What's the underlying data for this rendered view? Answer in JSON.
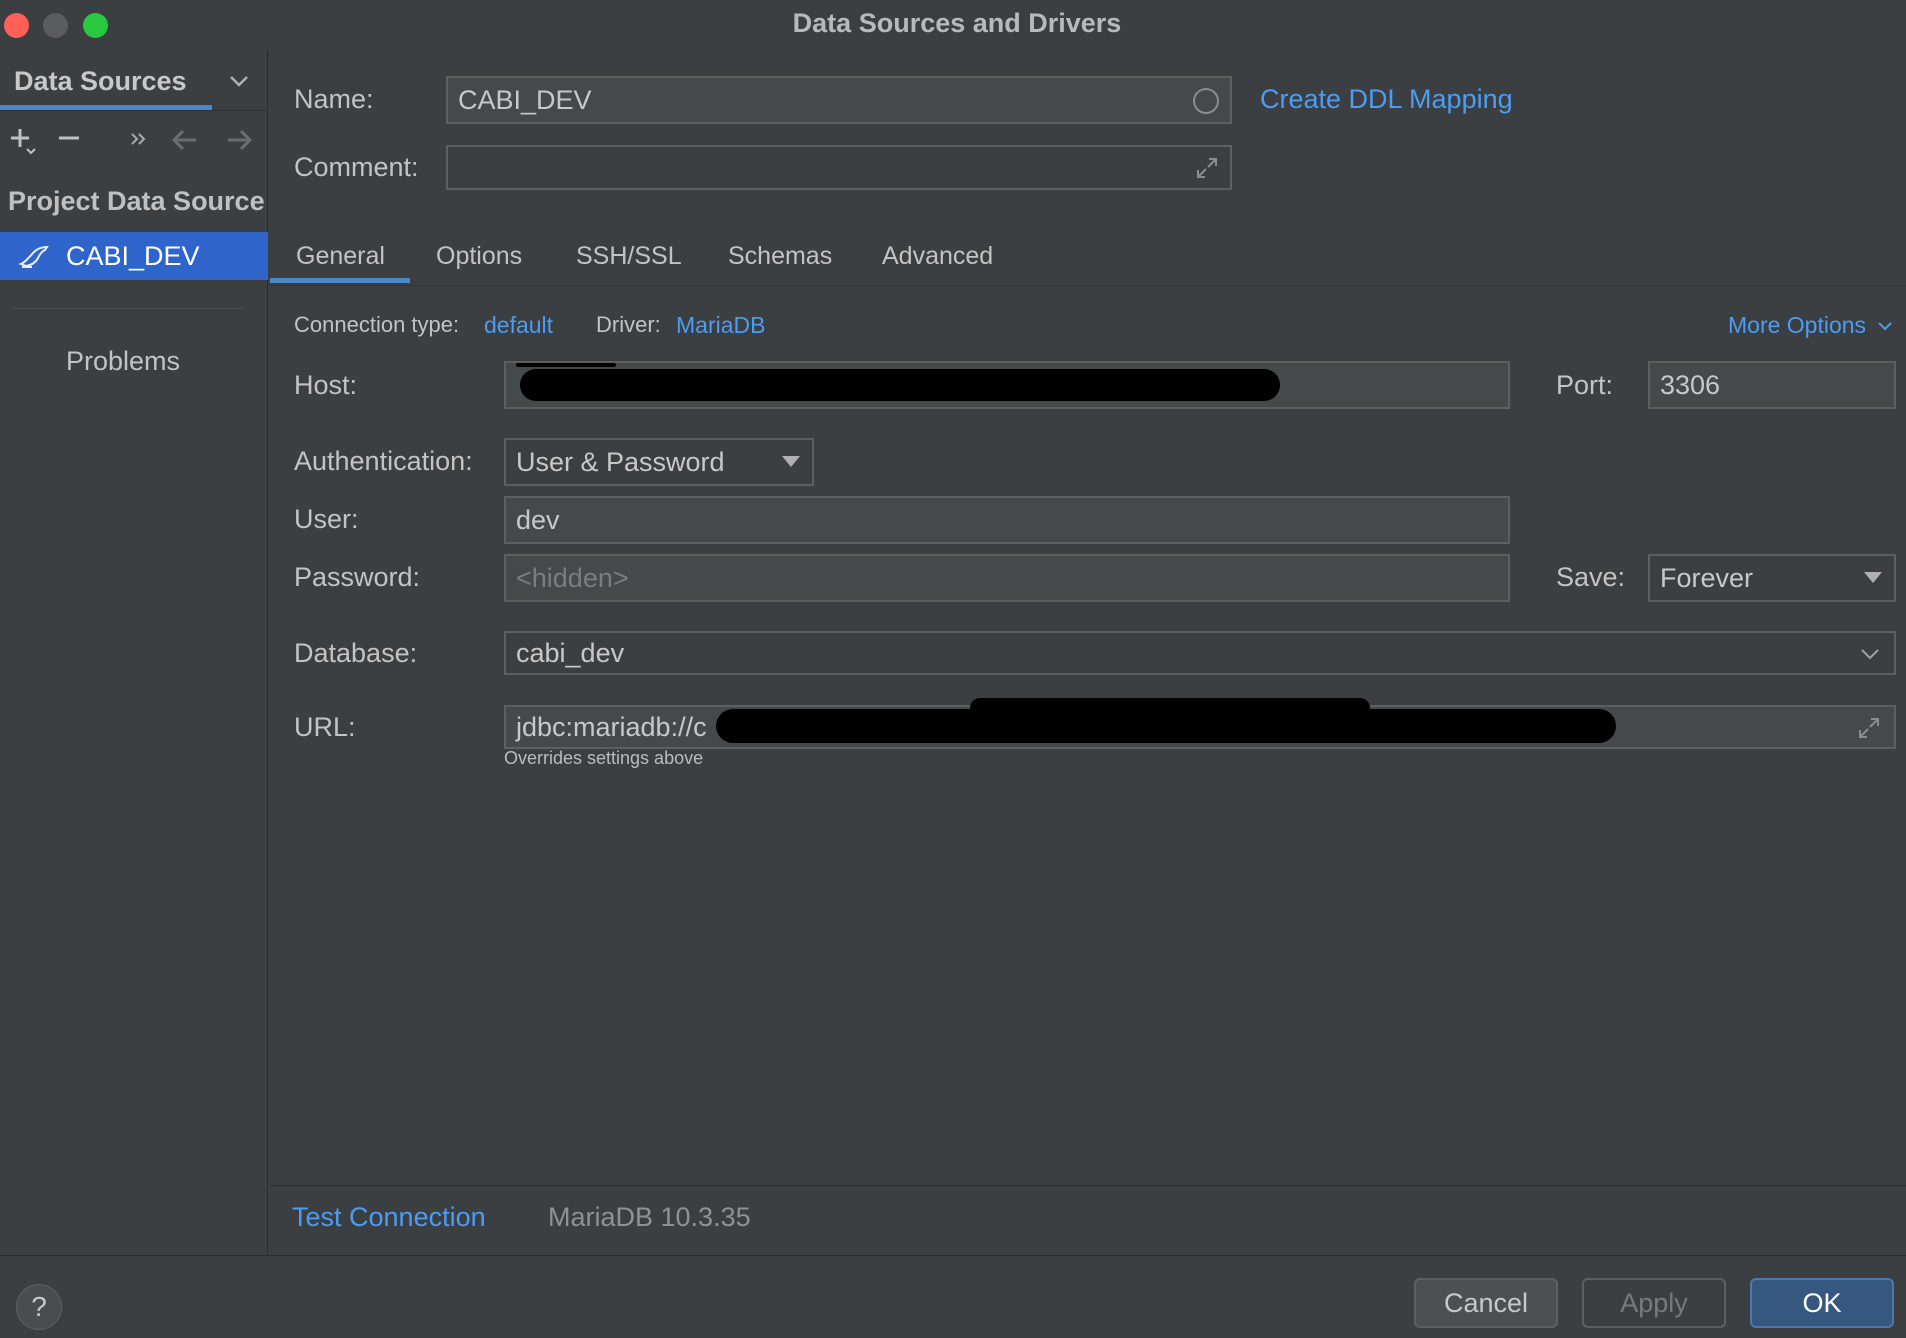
{
  "window": {
    "title": "Data Sources and Drivers"
  },
  "left": {
    "header": "Data Sources",
    "section": "Project Data Source",
    "items": [
      {
        "label": "CABI_DEV"
      }
    ],
    "problems": "Problems"
  },
  "form": {
    "name_label": "Name:",
    "name_value": "CABI_DEV",
    "ddl_link": "Create DDL Mapping",
    "comment_label": "Comment:",
    "comment_value": ""
  },
  "tabs": [
    "General",
    "Options",
    "SSH/SSL",
    "Schemas",
    "Advanced"
  ],
  "general": {
    "conn_type_label": "Connection type:",
    "conn_type_value": "default",
    "driver_label": "Driver:",
    "driver_value": "MariaDB",
    "more_options": "More Options",
    "host_label": "Host:",
    "port_label": "Port:",
    "port_value": "3306",
    "auth_label": "Authentication:",
    "auth_value": "User & Password",
    "user_label": "User:",
    "user_value": "dev",
    "password_label": "Password:",
    "password_placeholder": "<hidden>",
    "save_label": "Save:",
    "save_value": "Forever",
    "database_label": "Database:",
    "database_value": "cabi_dev",
    "url_label": "URL:",
    "url_value": "jdbc:mariadb://c",
    "url_hint": "Overrides settings above"
  },
  "status": {
    "test_connection": "Test Connection",
    "server_version": "MariaDB 10.3.35"
  },
  "footer": {
    "help": "?",
    "cancel": "Cancel",
    "apply": "Apply",
    "ok": "OK"
  },
  "colors": {
    "accent": "#4a88c7",
    "link": "#4b9cf5",
    "selection": "#2f65ca"
  }
}
